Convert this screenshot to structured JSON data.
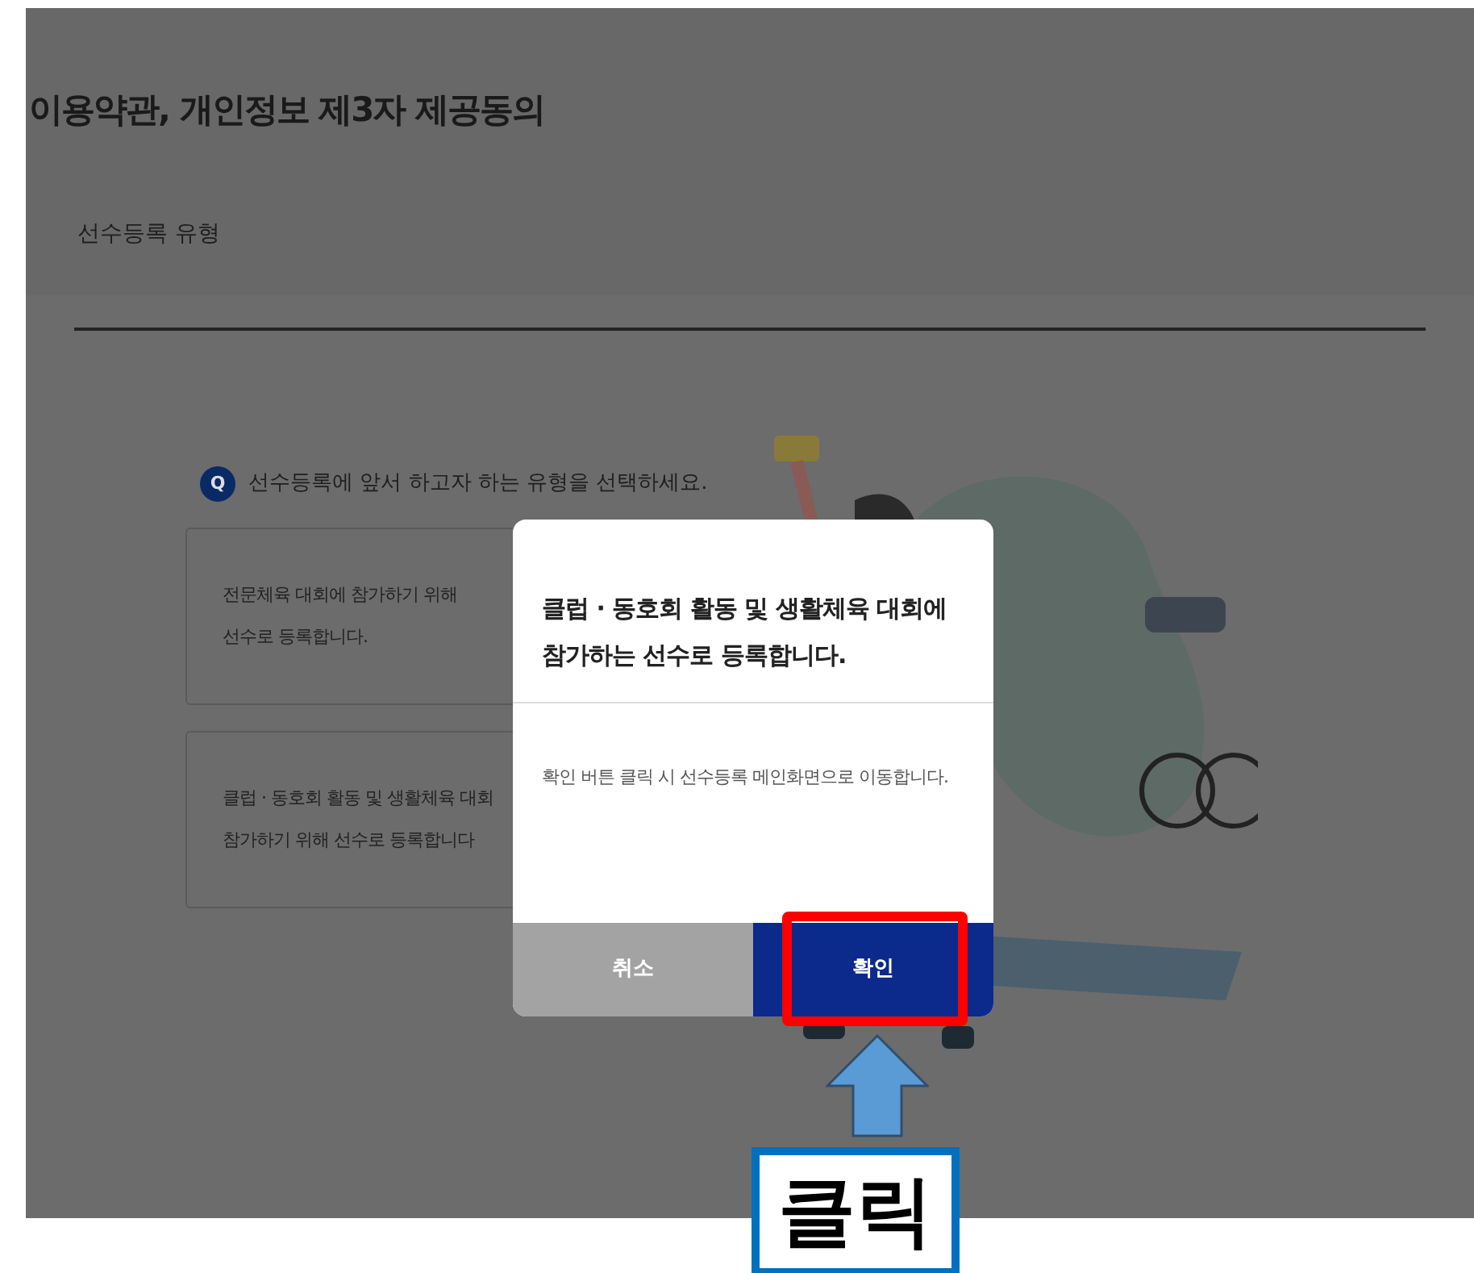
{
  "page": {
    "title": "이용약관, 개인정보 제3자 제공동의",
    "section_title": "선수등록 유형",
    "question": {
      "badge": "Q",
      "text": "선수등록에 앞서 하고자 하는 유형을 선택하세요."
    },
    "options": [
      {
        "lines": [
          "전문체육 대회에 참가하기 위해",
          "선수로 등록합니다."
        ]
      },
      {
        "lines": [
          "클럽 · 동호회 활동 및 생활체육 대회",
          "참가하기 위해 선수로 등록합니다"
        ]
      }
    ]
  },
  "dialog": {
    "title_lines": [
      "클럽 · 동호회 활동 및 생활체육 대회에",
      "참가하는 선수로 등록합니다."
    ],
    "message": "확인 버튼 클릭 시 선수등록 메인화면으로 이동합니다.",
    "buttons": [
      {
        "label": "취소",
        "kind": "cancel"
      },
      {
        "label": "확인",
        "kind": "confirm"
      }
    ]
  },
  "annotation": {
    "label": "클릭"
  }
}
